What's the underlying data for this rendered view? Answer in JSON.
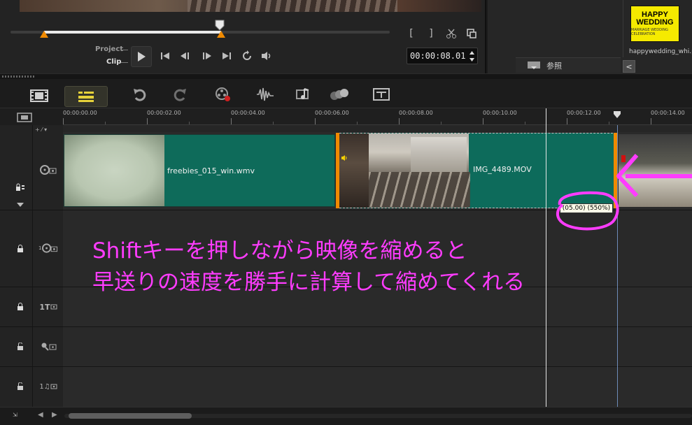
{
  "player": {
    "mode_project": "Project",
    "mode_clip": "Clip",
    "timecode": "00:00:08.01",
    "trim_in": "[",
    "trim_out": "]"
  },
  "library": {
    "browse_label": "参照",
    "thumbnail": {
      "title_line1": "HAPPY",
      "title_line2": "WEDDING",
      "subtitle": "MARRIAGE WEDDING CELEBRATION",
      "filename": "happywedding_whi.pn"
    },
    "scroll_glyph": "<"
  },
  "toolbar": {
    "storyboard_icon": "film-strip-icon",
    "timeline_icon": "timeline-view-icon",
    "undo_icon": "undo-icon",
    "redo_icon": "redo-icon",
    "record_icon": "record-capture-icon",
    "sound_icon": "sound-mixer-icon",
    "music_icon": "auto-music-icon",
    "motion_icon": "motion-tracking-icon",
    "subtitle_icon": "subtitle-editor-icon"
  },
  "ruler": {
    "ticks": [
      "00:00:00.00",
      "00:00:02.00",
      "00:00:04.00",
      "00:00:06.00",
      "00:00:08.00",
      "00:00:10.00",
      "00:00:12.00",
      "00:00:14.00"
    ]
  },
  "tracks": {
    "add_track_glyph": "+ ⁄ ▾",
    "video": {
      "clips": [
        {
          "name": "freebies_015_win.wmv"
        },
        {
          "name": "IMG_4489.MOV"
        },
        {
          "name": ""
        }
      ],
      "speed_tooltip": "(05.00) (550%)"
    },
    "overlay_label": "1",
    "title_label": "1T",
    "voice_label": "",
    "music_label": "1♫"
  },
  "annotation": {
    "line1": "Shiftキーを押しながら映像を縮めると",
    "line2": "早送りの速度を勝手に計算して縮めてくれる",
    "color": "#ff3cff"
  },
  "colors": {
    "clip_teal": "#0e6b5a",
    "trim_orange": "#f08a00",
    "accent_yellow": "#e6d23a"
  }
}
